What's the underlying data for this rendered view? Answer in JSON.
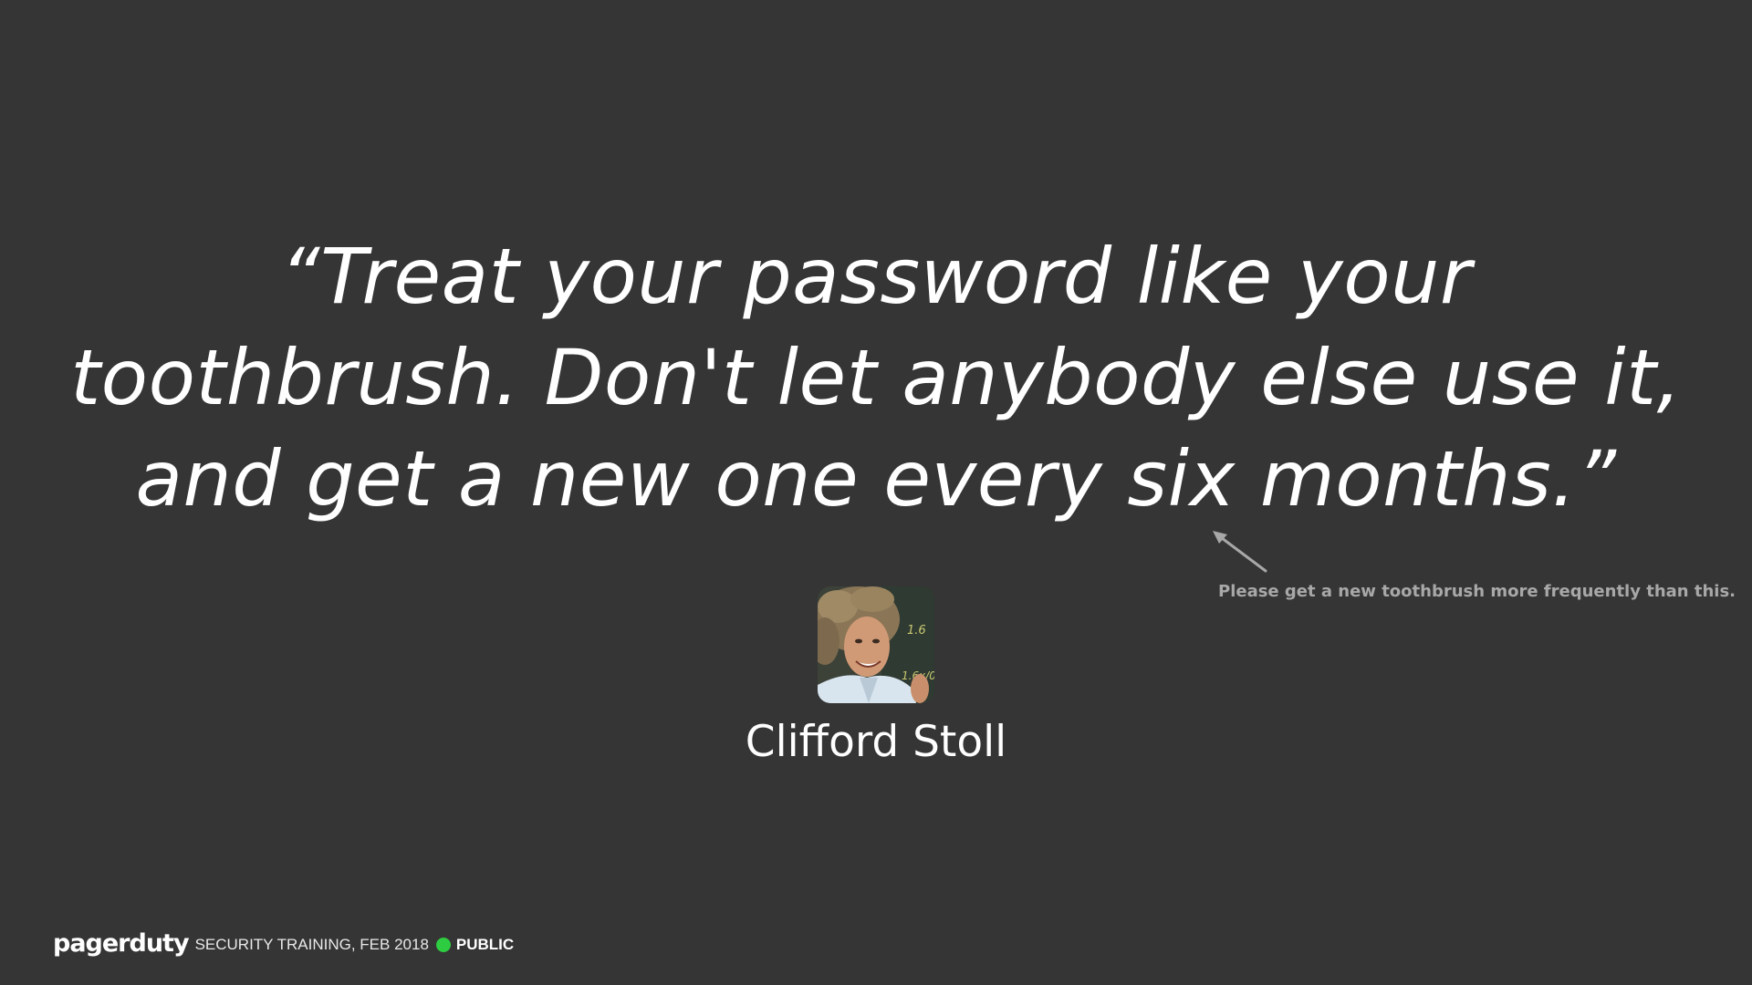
{
  "slide": {
    "quote_lines": [
      "“Treat your password like your",
      "toothbrush. Don't let anybody else use it,",
      "and get a new one every six months.”"
    ],
    "annotation": "Please get a new toothbrush more frequently than this.",
    "author": "Clifford Stoll",
    "avatar_icon": "portrait-photo"
  },
  "footer": {
    "brand": "pagerduty",
    "event": "SECURITY TRAINING, FEB 2018",
    "classification": "PUBLIC",
    "status_color": "#2ecc40"
  },
  "colors": {
    "background": "#353535",
    "text": "#ffffff",
    "annotation": "#a8a8a8"
  }
}
